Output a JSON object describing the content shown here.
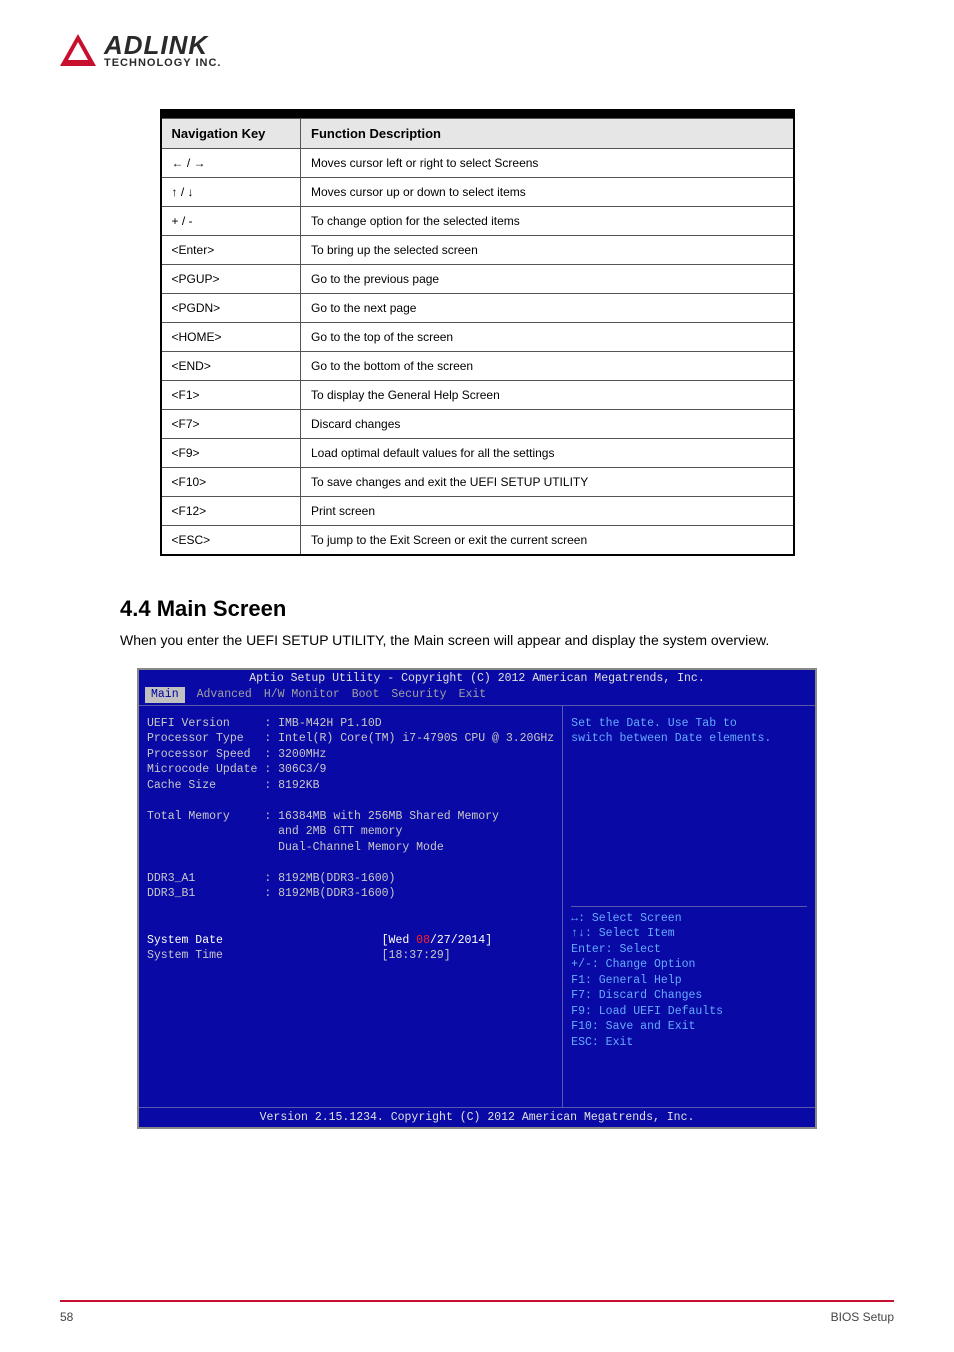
{
  "logo": {
    "main": "ADLINK",
    "sub": "TECHNOLOGY INC."
  },
  "nav_table": {
    "headers": [
      "Navigation Key",
      "Function Description"
    ],
    "rows": [
      [
        "← / →",
        "Moves cursor left or right to select Screens"
      ],
      [
        "↑ / ↓",
        "Moves cursor up or down to select items"
      ],
      [
        "+ / -",
        "To change option for the selected items"
      ],
      [
        "<Enter>",
        "To bring up the selected screen"
      ],
      [
        "<PGUP>",
        "Go to the previous page"
      ],
      [
        "<PGDN>",
        "Go to the next page"
      ],
      [
        "<HOME>",
        "Go to the top of the screen"
      ],
      [
        "<END>",
        "Go to the bottom of the screen"
      ],
      [
        "<F1>",
        "To display the General Help Screen"
      ],
      [
        "<F7>",
        "Discard changes"
      ],
      [
        "<F9>",
        "Load optimal default values for all the settings"
      ],
      [
        "<F10>",
        "To save changes and exit the UEFI SETUP UTILITY"
      ],
      [
        "<F12>",
        "Print screen"
      ],
      [
        "<ESC>",
        "To jump to the Exit Screen or exit the current screen"
      ]
    ]
  },
  "section": {
    "heading": "4.4   Main Screen",
    "para": "When you enter the UEFI SETUP UTILITY, the Main screen will appear and display the system overview."
  },
  "bios": {
    "title": "Aptio Setup Utility - Copyright (C) 2012 American Megatrends, Inc.",
    "tabs": [
      "Main",
      "Advanced",
      "H/W Monitor",
      "Boot",
      "Security",
      "Exit"
    ],
    "left_lines": [
      "UEFI Version     : IMB-M42H P1.10D",
      "Processor Type   : Intel(R) Core(TM) i7-4790S CPU @ 3.20GHz",
      "Processor Speed  : 3200MHz",
      "Microcode Update : 306C3/9",
      "Cache Size       : 8192KB",
      "",
      "Total Memory     : 16384MB with 256MB Shared Memory",
      "                   and 2MB GTT memory",
      "                   Dual-Channel Memory Mode",
      "",
      "DDR3_A1          : 8192MB(DDR3-1600)",
      "DDR3_B1          : 8192MB(DDR3-1600)",
      "",
      ""
    ],
    "date_label": "System Date",
    "date_value_prefix": "[Wed ",
    "date_value_highlight": "08",
    "date_value_suffix": "/27/2014]",
    "time_label": "System Time",
    "time_value": "[18:37:29]",
    "right_help1": "Set the Date. Use Tab to",
    "right_help2": "switch between Date elements.",
    "right_nav": [
      "↔: Select Screen",
      "↑↓: Select Item",
      "Enter: Select",
      "+/-: Change Option",
      "F1: General Help",
      "F7: Discard Changes",
      "F9: Load UEFI Defaults",
      "F10: Save and Exit",
      "ESC: Exit"
    ],
    "footer": "Version 2.15.1234. Copyright (C) 2012 American Megatrends, Inc."
  },
  "page_footer": {
    "num": "58",
    "title": "BIOS Setup"
  }
}
